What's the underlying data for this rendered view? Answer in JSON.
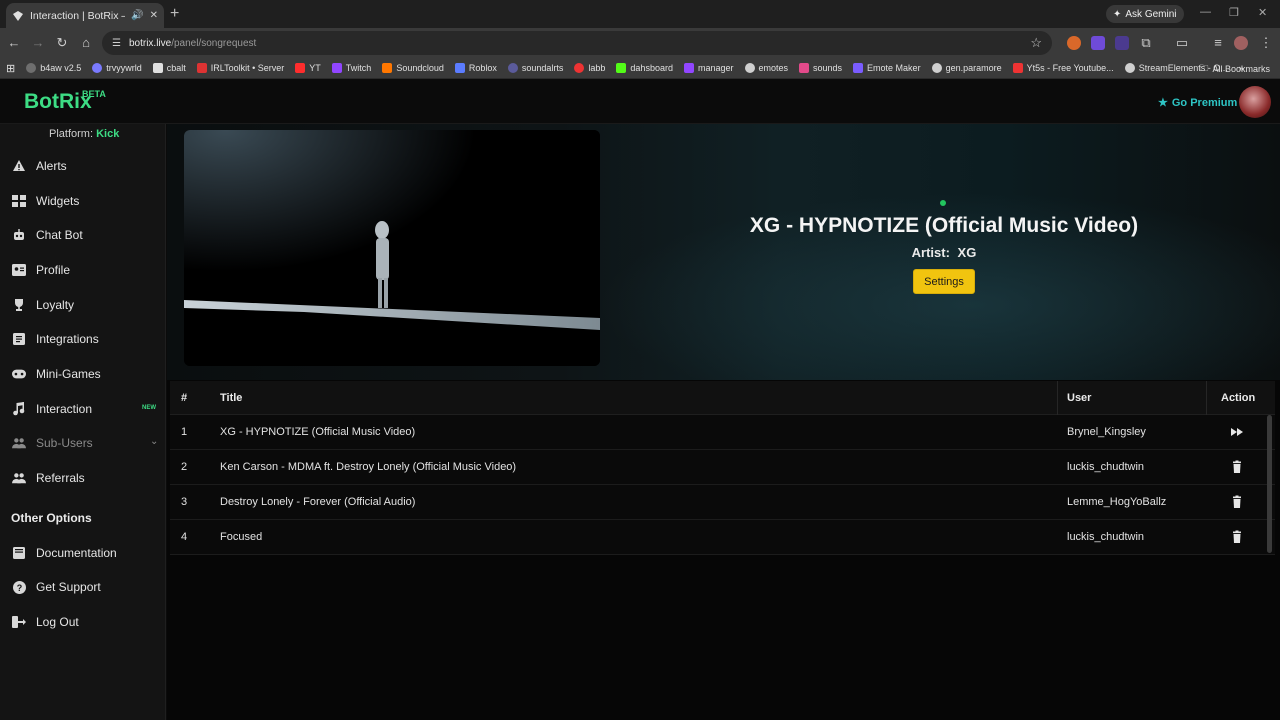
{
  "browser": {
    "tab_title": "Interaction | BotRix — Cloud",
    "new_tab": "+",
    "ask_gemini": "Ask Gemini",
    "url_host": "botrix.live",
    "url_path": "/panel/songrequest",
    "bookmarks": [
      {
        "label": "b4aw v2.5",
        "color": "#6e6e6e"
      },
      {
        "label": "trvyywrld",
        "color": "#7a7aff"
      },
      {
        "label": "cbalt",
        "color": "#e0e0e0"
      },
      {
        "label": "IRLToolkit • Server",
        "color": "#d33"
      },
      {
        "label": "YT",
        "color": "#ff2d2d"
      },
      {
        "label": "Twitch",
        "color": "#9146ff"
      },
      {
        "label": "Soundcloud",
        "color": "#ff7700"
      },
      {
        "label": "Roblox",
        "color": "#5b7cff"
      },
      {
        "label": "soundalrts",
        "color": "#5b5b9b"
      },
      {
        "label": "labb",
        "color": "#e33"
      },
      {
        "label": "dahsboard",
        "color": "#53fc18"
      },
      {
        "label": "manager",
        "color": "#9146ff"
      },
      {
        "label": "emotes",
        "color": "#cfcfcf"
      },
      {
        "label": "sounds",
        "color": "#e24a8a"
      },
      {
        "label": "Emote Maker",
        "color": "#7a5cff"
      },
      {
        "label": "gen.paramore",
        "color": "#cfcfcf"
      },
      {
        "label": "Yt5s - Free Youtube...",
        "color": "#e33"
      },
      {
        "label": "StreamElements - O...",
        "color": "#cfcfcf"
      }
    ],
    "more_bookmarks": "»",
    "all_bookmarks": "All Bookmarks"
  },
  "header": {
    "logo": "BotRix",
    "beta": "BETA",
    "go_premium": "Go Premium"
  },
  "sidebar": {
    "platform_label": "Platform:",
    "platform_value": "Kick",
    "items": [
      {
        "label": "Alerts",
        "icon": "warning-icon"
      },
      {
        "label": "Widgets",
        "icon": "grid-icon"
      },
      {
        "label": "Chat Bot",
        "icon": "robot-icon"
      },
      {
        "label": "Profile",
        "icon": "id-card-icon"
      },
      {
        "label": "Loyalty",
        "icon": "trophy-icon"
      },
      {
        "label": "Integrations",
        "icon": "plug-icon"
      },
      {
        "label": "Mini-Games",
        "icon": "gamepad-icon"
      },
      {
        "label": "Interaction",
        "icon": "music-icon",
        "badge": "NEW"
      },
      {
        "label": "Sub-Users",
        "icon": "users-icon"
      },
      {
        "label": "Referrals",
        "icon": "users-icon"
      }
    ],
    "other_options": "Other Options",
    "other_items": [
      {
        "label": "Documentation",
        "icon": "book-icon"
      },
      {
        "label": "Get Support",
        "icon": "question-icon"
      },
      {
        "label": "Log Out",
        "icon": "logout-icon"
      }
    ]
  },
  "now_playing": {
    "title": "XG - HYPNOTIZE (Official Music Video)",
    "artist_label": "Artist:",
    "artist_value": "XG",
    "settings": "Settings"
  },
  "queue": {
    "columns": [
      "#",
      "Title",
      "User",
      "Action"
    ],
    "rows": [
      {
        "num": "1",
        "title": "XG - HYPNOTIZE (Official Music Video)",
        "user": "Brynel_Kingsley",
        "action": "skip-icon"
      },
      {
        "num": "2",
        "title": "Ken Carson - MDMA ft. Destroy Lonely (Official Music Video)",
        "user": "luckis_chudtwin",
        "action": "trash-icon"
      },
      {
        "num": "3",
        "title": "Destroy Lonely - Forever (Official Audio)",
        "user": "Lemme_HogYoBallz",
        "action": "trash-icon"
      },
      {
        "num": "4",
        "title": "Focused",
        "user": "luckis_chudtwin",
        "action": "trash-icon"
      }
    ]
  },
  "colors": {
    "brand": "#3ddc84",
    "premium": "#2ec4c4",
    "settings_button": "#f1c40f",
    "status": "#22c55e"
  }
}
